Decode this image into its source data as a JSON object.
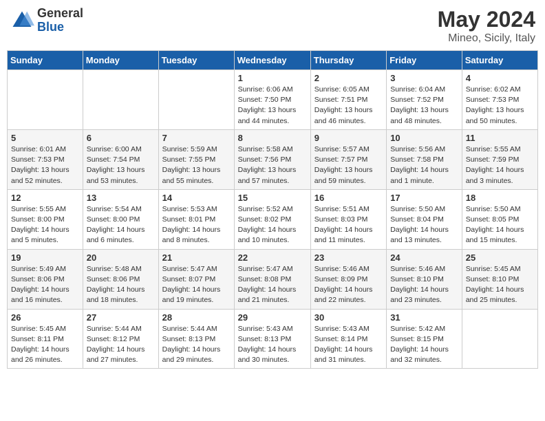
{
  "header": {
    "logo_general": "General",
    "logo_blue": "Blue",
    "month_year": "May 2024",
    "location": "Mineo, Sicily, Italy"
  },
  "days_of_week": [
    "Sunday",
    "Monday",
    "Tuesday",
    "Wednesday",
    "Thursday",
    "Friday",
    "Saturday"
  ],
  "weeks": [
    [
      {
        "day": "",
        "info": ""
      },
      {
        "day": "",
        "info": ""
      },
      {
        "day": "",
        "info": ""
      },
      {
        "day": "1",
        "info": "Sunrise: 6:06 AM\nSunset: 7:50 PM\nDaylight: 13 hours\nand 44 minutes."
      },
      {
        "day": "2",
        "info": "Sunrise: 6:05 AM\nSunset: 7:51 PM\nDaylight: 13 hours\nand 46 minutes."
      },
      {
        "day": "3",
        "info": "Sunrise: 6:04 AM\nSunset: 7:52 PM\nDaylight: 13 hours\nand 48 minutes."
      },
      {
        "day": "4",
        "info": "Sunrise: 6:02 AM\nSunset: 7:53 PM\nDaylight: 13 hours\nand 50 minutes."
      }
    ],
    [
      {
        "day": "5",
        "info": "Sunrise: 6:01 AM\nSunset: 7:53 PM\nDaylight: 13 hours\nand 52 minutes."
      },
      {
        "day": "6",
        "info": "Sunrise: 6:00 AM\nSunset: 7:54 PM\nDaylight: 13 hours\nand 53 minutes."
      },
      {
        "day": "7",
        "info": "Sunrise: 5:59 AM\nSunset: 7:55 PM\nDaylight: 13 hours\nand 55 minutes."
      },
      {
        "day": "8",
        "info": "Sunrise: 5:58 AM\nSunset: 7:56 PM\nDaylight: 13 hours\nand 57 minutes."
      },
      {
        "day": "9",
        "info": "Sunrise: 5:57 AM\nSunset: 7:57 PM\nDaylight: 13 hours\nand 59 minutes."
      },
      {
        "day": "10",
        "info": "Sunrise: 5:56 AM\nSunset: 7:58 PM\nDaylight: 14 hours\nand 1 minute."
      },
      {
        "day": "11",
        "info": "Sunrise: 5:55 AM\nSunset: 7:59 PM\nDaylight: 14 hours\nand 3 minutes."
      }
    ],
    [
      {
        "day": "12",
        "info": "Sunrise: 5:55 AM\nSunset: 8:00 PM\nDaylight: 14 hours\nand 5 minutes."
      },
      {
        "day": "13",
        "info": "Sunrise: 5:54 AM\nSunset: 8:00 PM\nDaylight: 14 hours\nand 6 minutes."
      },
      {
        "day": "14",
        "info": "Sunrise: 5:53 AM\nSunset: 8:01 PM\nDaylight: 14 hours\nand 8 minutes."
      },
      {
        "day": "15",
        "info": "Sunrise: 5:52 AM\nSunset: 8:02 PM\nDaylight: 14 hours\nand 10 minutes."
      },
      {
        "day": "16",
        "info": "Sunrise: 5:51 AM\nSunset: 8:03 PM\nDaylight: 14 hours\nand 11 minutes."
      },
      {
        "day": "17",
        "info": "Sunrise: 5:50 AM\nSunset: 8:04 PM\nDaylight: 14 hours\nand 13 minutes."
      },
      {
        "day": "18",
        "info": "Sunrise: 5:50 AM\nSunset: 8:05 PM\nDaylight: 14 hours\nand 15 minutes."
      }
    ],
    [
      {
        "day": "19",
        "info": "Sunrise: 5:49 AM\nSunset: 8:06 PM\nDaylight: 14 hours\nand 16 minutes."
      },
      {
        "day": "20",
        "info": "Sunrise: 5:48 AM\nSunset: 8:06 PM\nDaylight: 14 hours\nand 18 minutes."
      },
      {
        "day": "21",
        "info": "Sunrise: 5:47 AM\nSunset: 8:07 PM\nDaylight: 14 hours\nand 19 minutes."
      },
      {
        "day": "22",
        "info": "Sunrise: 5:47 AM\nSunset: 8:08 PM\nDaylight: 14 hours\nand 21 minutes."
      },
      {
        "day": "23",
        "info": "Sunrise: 5:46 AM\nSunset: 8:09 PM\nDaylight: 14 hours\nand 22 minutes."
      },
      {
        "day": "24",
        "info": "Sunrise: 5:46 AM\nSunset: 8:10 PM\nDaylight: 14 hours\nand 23 minutes."
      },
      {
        "day": "25",
        "info": "Sunrise: 5:45 AM\nSunset: 8:10 PM\nDaylight: 14 hours\nand 25 minutes."
      }
    ],
    [
      {
        "day": "26",
        "info": "Sunrise: 5:45 AM\nSunset: 8:11 PM\nDaylight: 14 hours\nand 26 minutes."
      },
      {
        "day": "27",
        "info": "Sunrise: 5:44 AM\nSunset: 8:12 PM\nDaylight: 14 hours\nand 27 minutes."
      },
      {
        "day": "28",
        "info": "Sunrise: 5:44 AM\nSunset: 8:13 PM\nDaylight: 14 hours\nand 29 minutes."
      },
      {
        "day": "29",
        "info": "Sunrise: 5:43 AM\nSunset: 8:13 PM\nDaylight: 14 hours\nand 30 minutes."
      },
      {
        "day": "30",
        "info": "Sunrise: 5:43 AM\nSunset: 8:14 PM\nDaylight: 14 hours\nand 31 minutes."
      },
      {
        "day": "31",
        "info": "Sunrise: 5:42 AM\nSunset: 8:15 PM\nDaylight: 14 hours\nand 32 minutes."
      },
      {
        "day": "",
        "info": ""
      }
    ]
  ]
}
